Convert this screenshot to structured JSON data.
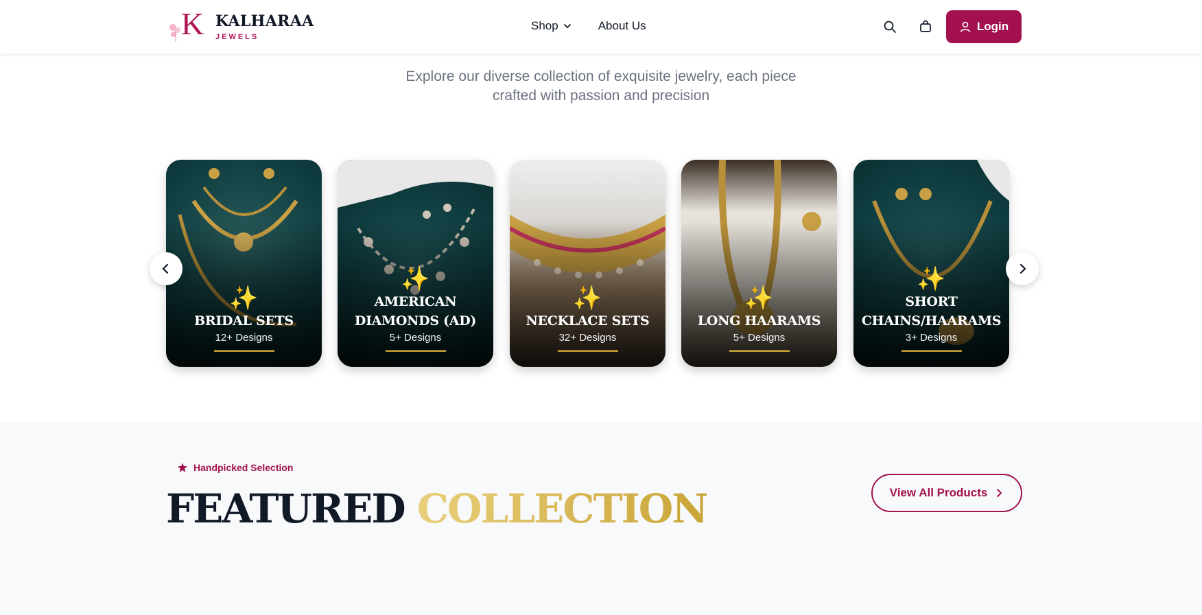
{
  "header": {
    "brand_name": "KALHARAA",
    "brand_sub": "JEWELS",
    "nav": [
      {
        "label": "Shop",
        "has_dropdown": true
      },
      {
        "label": "About Us",
        "has_dropdown": false
      }
    ],
    "login_label": "Login",
    "icons": [
      "search-icon",
      "bag-icon",
      "user-icon"
    ]
  },
  "intro": {
    "line1": "Explore our diverse collection of exquisite jewelry, each piece",
    "line2": "crafted with passion and precision"
  },
  "categories": [
    {
      "title": "BRIDAL SETS",
      "count": "12+ Designs"
    },
    {
      "title": "AMERICAN DIAMONDS (AD)",
      "count": "5+ Designs"
    },
    {
      "title": "NECKLACE SETS",
      "count": "32+ Designs"
    },
    {
      "title": "LONG HAARAMS",
      "count": "5+ Designs"
    },
    {
      "title": "SHORT CHAINS/HAARAMS",
      "count": "3+ Designs"
    }
  ],
  "featured": {
    "badge": "Handpicked Selection",
    "title_part1": "FEATURED",
    "title_part2": "COLLECTION",
    "view_all_label": "View All Products"
  },
  "colors": {
    "brand": "#a3104f",
    "gold": "#e0b53c",
    "card_bg_teal": "#0d3b3f"
  }
}
